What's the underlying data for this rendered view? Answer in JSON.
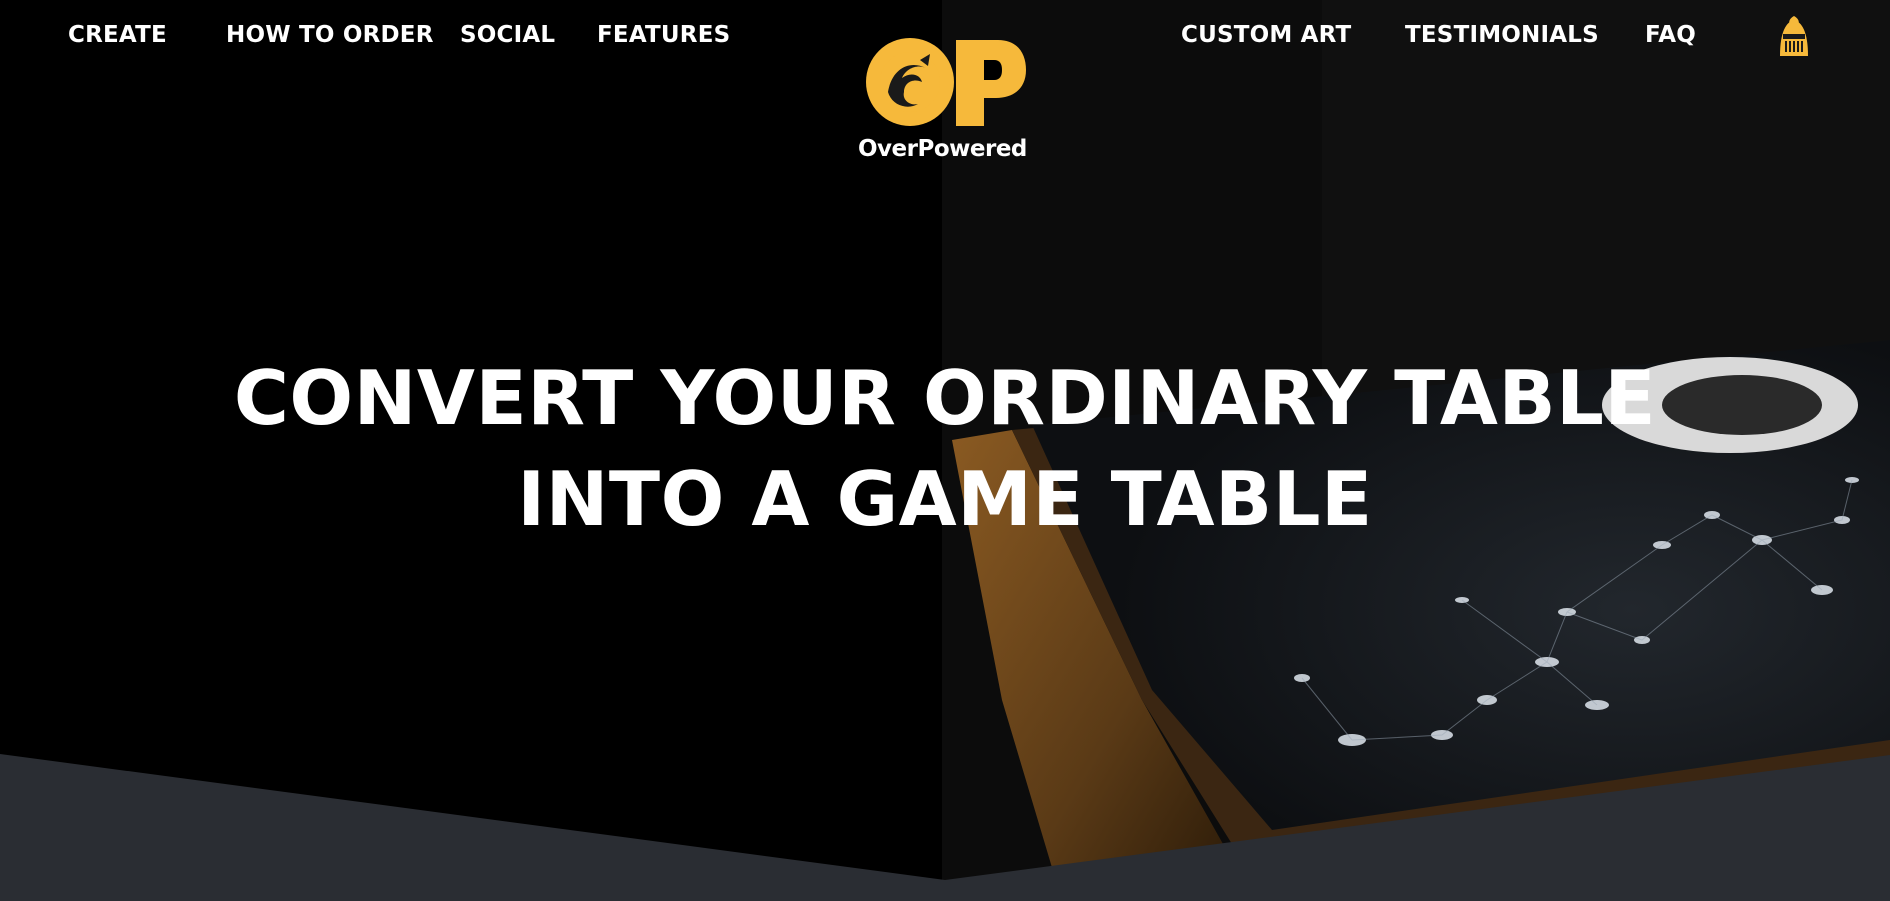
{
  "nav": {
    "left": [
      {
        "label": "CREATE"
      },
      {
        "label": "HOW TO ORDER"
      },
      {
        "label": "SOCIAL"
      },
      {
        "label": "FEATURES"
      }
    ],
    "right": [
      {
        "label": "CUSTOM ART"
      },
      {
        "label": "TESTIMONIALS"
      },
      {
        "label": "FAQ"
      }
    ],
    "account_icon": "knight-helmet-icon"
  },
  "logo": {
    "wordmark": "OverPowered",
    "mark": "OP",
    "color": "#f6b93b"
  },
  "hero": {
    "headline_line1": "CONVERT YOUR ORDINARY TABLE",
    "headline_line2": "INTO A GAME TABLE"
  },
  "colors": {
    "background": "#000000",
    "accent": "#f6b93b",
    "band": "#2a2d33",
    "text": "#ffffff"
  }
}
